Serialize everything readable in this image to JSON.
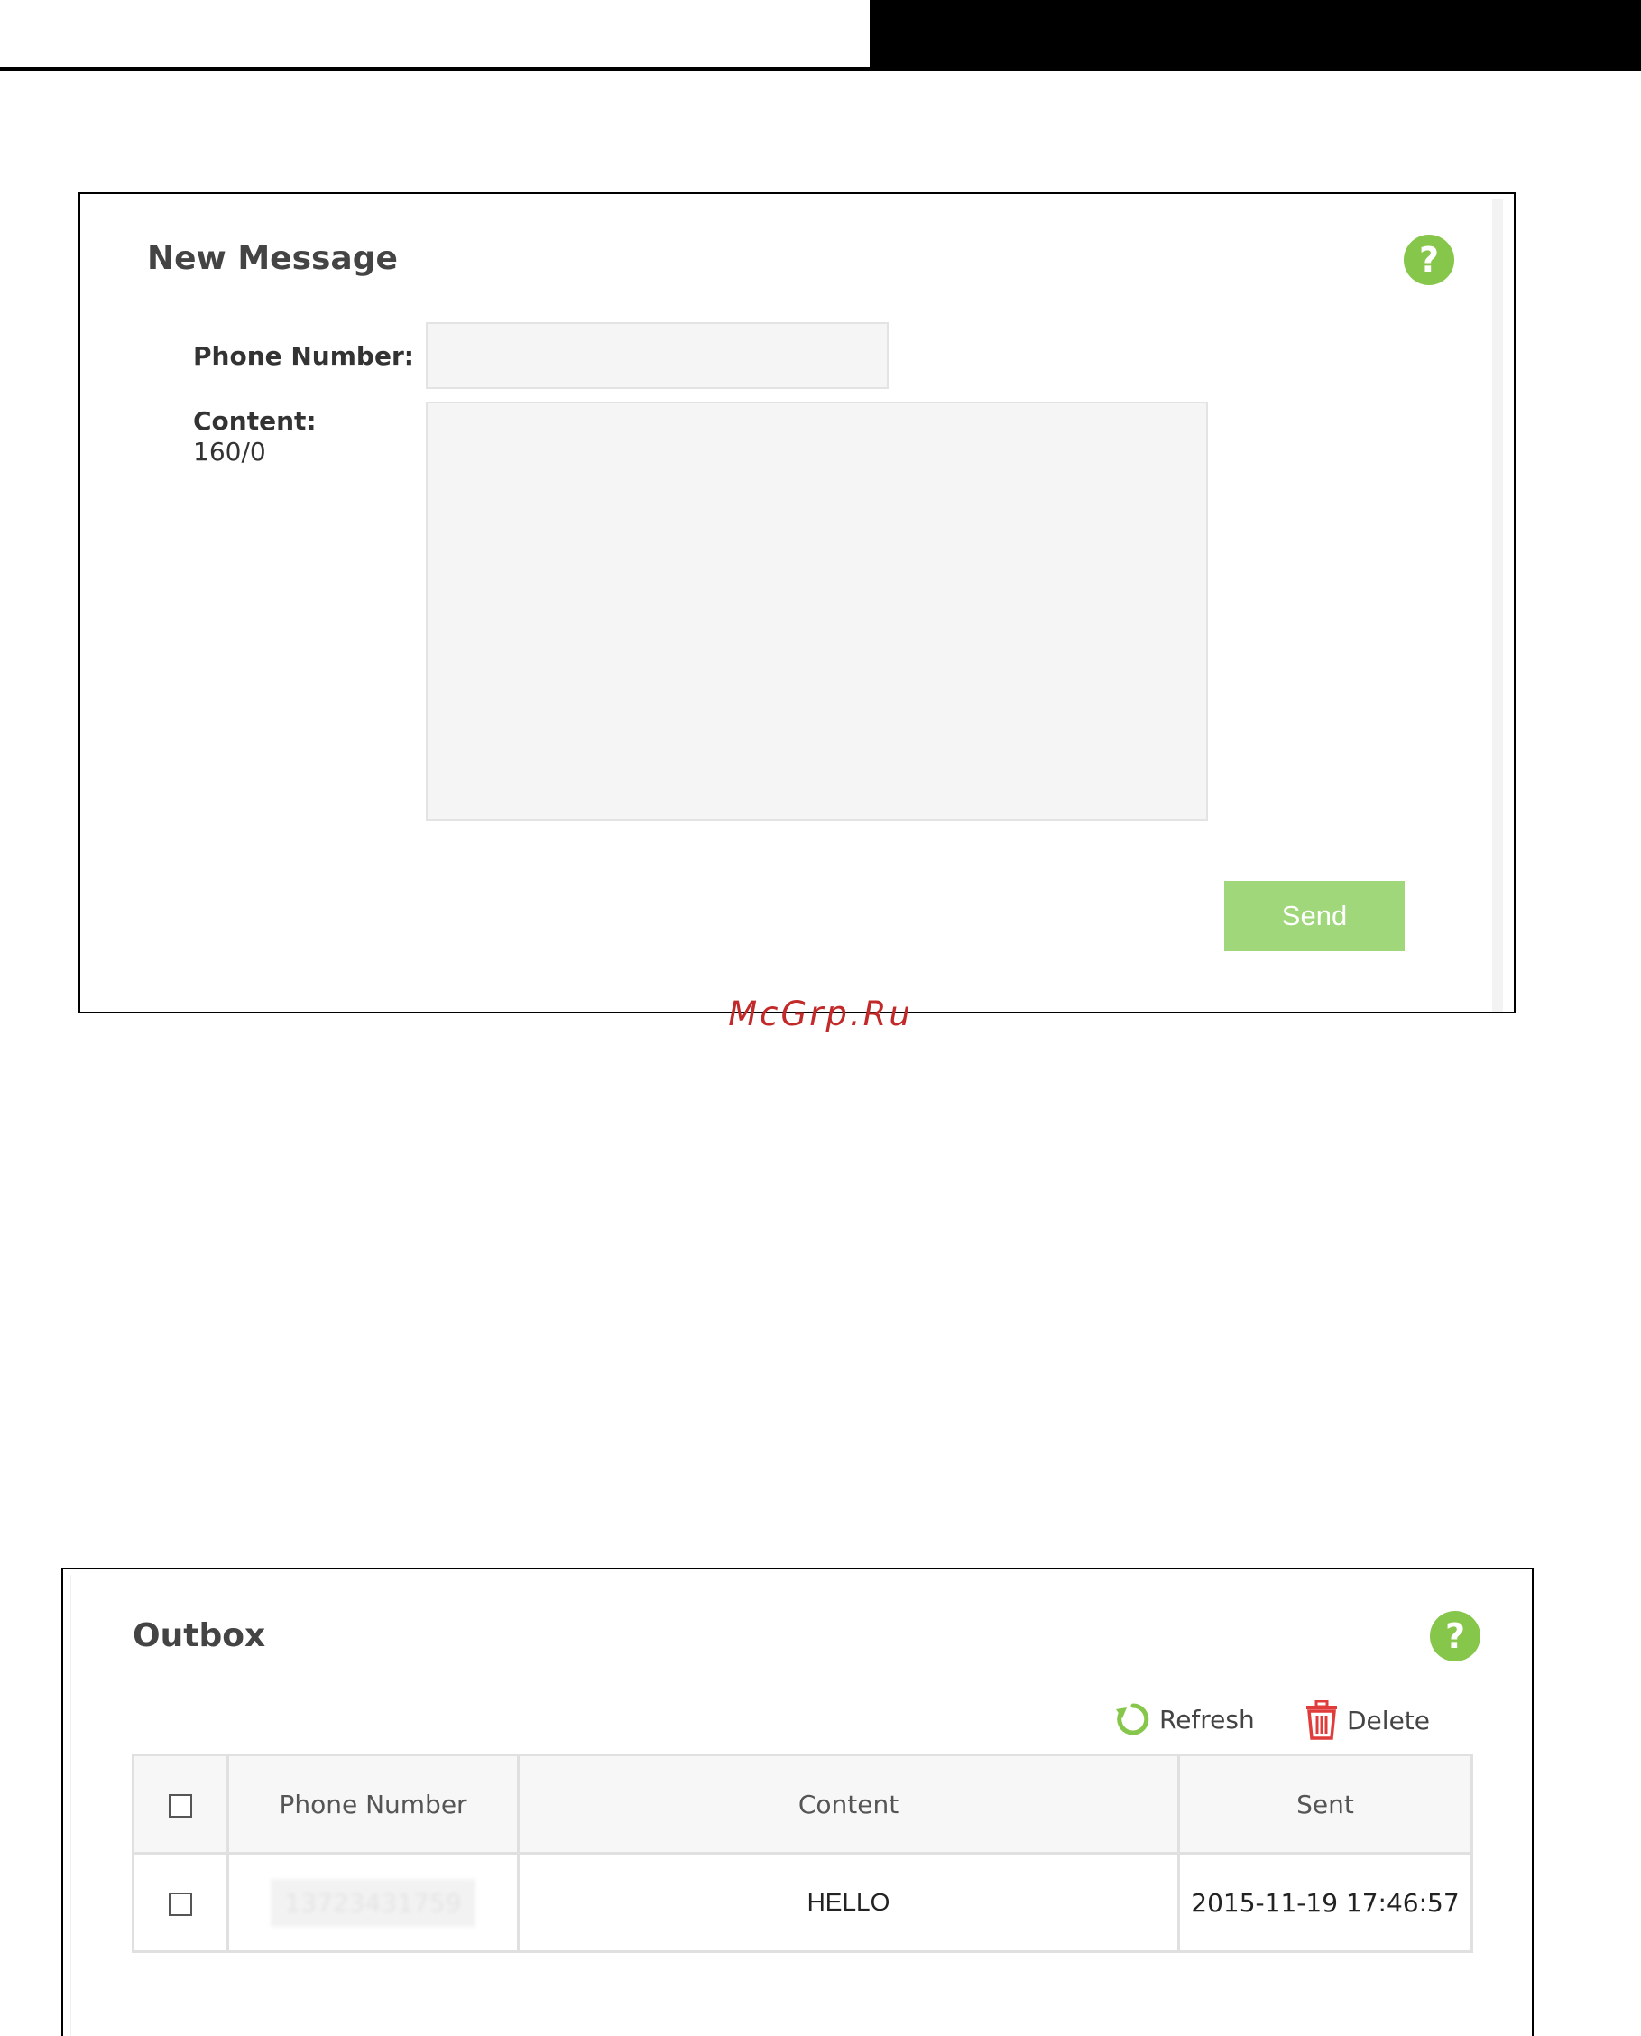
{
  "new_message": {
    "title": "New Message",
    "help": "?",
    "phone_label": "Phone Number:",
    "content_label": "Content:",
    "char_count": "160/0",
    "phone_value": "",
    "content_value": "",
    "send_label": "Send"
  },
  "watermark": "McGrp.Ru",
  "outbox": {
    "title": "Outbox",
    "help": "?",
    "refresh_label": "Refresh",
    "delete_label": "Delete",
    "columns": [
      "Phone Number",
      "Content",
      "Sent"
    ],
    "rows": [
      {
        "phone": "13723431759",
        "content": "HELLO",
        "sent": "2015-11-19 17:46:57"
      }
    ]
  },
  "colors": {
    "accent_green": "#86c64a",
    "button_green": "#9fd77a",
    "delete_red": "#e03c3c",
    "watermark_red": "#c22a2a"
  }
}
